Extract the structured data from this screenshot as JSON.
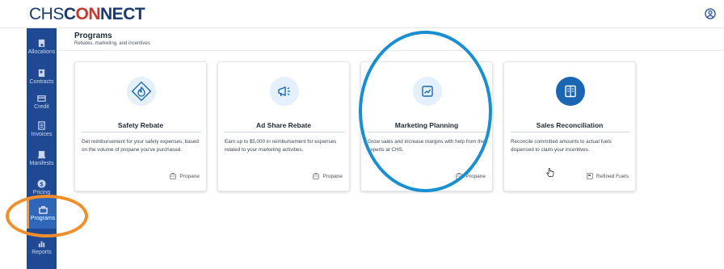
{
  "app": {
    "logo_prefix": "CHS",
    "logo_c": "C",
    "logo_on": "ON",
    "logo_suffix": "NECT"
  },
  "sidebar": {
    "items": [
      {
        "label": "Allocations",
        "icon": "allocations-icon"
      },
      {
        "label": "Contracts",
        "icon": "contracts-icon"
      },
      {
        "label": "Credit",
        "icon": "credit-card-icon"
      },
      {
        "label": "Invoices",
        "icon": "invoices-icon"
      },
      {
        "label": "Manifests",
        "icon": "manifests-icon"
      },
      {
        "label": "Pricing",
        "icon": "dollar-icon"
      },
      {
        "label": "Programs",
        "icon": "briefcase-icon",
        "active": true
      },
      {
        "label": "Reports",
        "icon": "reports-icon"
      }
    ]
  },
  "page": {
    "title": "Programs",
    "subtitle": "Rebates, marketing, and incentives"
  },
  "cards": [
    {
      "title": "Safety Rebate",
      "description": "Get reimbursement for your safety expenses, based on the volume of propane you've purchased.",
      "tag": "Propane",
      "icon": "flame-shield-icon"
    },
    {
      "title": "Ad Share Rebate",
      "description": "Earn up to $5,000 in reimbursement for expenses related to your marketing activities.",
      "tag": "Propane",
      "icon": "megaphone-icon"
    },
    {
      "title": "Marketing Planning",
      "description": "Grow sales and increase margins with help from the experts at CHS.",
      "tag": "Propane",
      "icon": "trend-chart-icon"
    },
    {
      "title": "Sales Reconciliation",
      "description": "Reconcile committed amounts to actual fuels dispensed to claim your incentives.",
      "tag": "Refined Fuels",
      "icon": "ledger-icon"
    }
  ],
  "colors": {
    "sidebar": "#1f4a93",
    "sidebar_active": "#2f66b9",
    "accent_orange": "#ef8e2a",
    "annotation_blue": "#1a8fd0",
    "brand_red": "#c43a2f"
  }
}
